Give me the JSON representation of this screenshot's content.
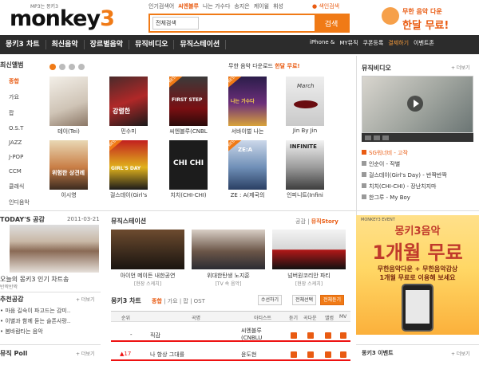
{
  "header": {
    "logo_tagline": "MP3는 몽키3",
    "logo_text": "monkey",
    "logo_num": "3",
    "popular_tags": [
      "인기검색어",
      "씨엔블루",
      "나는 가수다",
      "송지은",
      "케이윌",
      "휘성"
    ],
    "search_helper": "● 색인검색",
    "search_scope": "전체검색",
    "search_placeholder": "",
    "search_button": "검색",
    "promo_line1": "무한 음악 다운",
    "promo_line2": "한달 무료!"
  },
  "nav": {
    "items": [
      "몽키3 차트",
      "최신음악",
      "장르별음악",
      "뮤직비디오",
      "뮤직스테이션"
    ],
    "right": [
      "iPhone & ",
      "MY뮤직",
      "쿠폰등록",
      "결제하기",
      "이벤트존"
    ]
  },
  "album_section": {
    "title": "최신앨범",
    "categories": [
      "종합",
      "가요",
      "팝",
      "O.S.T",
      "JAZZ",
      "J-POP",
      "CCM",
      "클래식",
      "인디음악"
    ],
    "active_category": "종합",
    "promo_prefix": "무한 음악 다운로드",
    "promo_hi": "한달 무료!",
    "albums": [
      {
        "title": "테이(Tei)",
        "cover": "테이"
      },
      {
        "title": "민수미",
        "cover": "강렬한"
      },
      {
        "title": "씨엔블루(CNBL",
        "cover": "FIRST STEP"
      },
      {
        "title": "서바이벌 나는 ",
        "cover": "나는 가수다"
      },
      {
        "title": "Jin By Jin",
        "cover": "March"
      },
      {
        "title": "이시영",
        "cover": "위험한 상견례"
      },
      {
        "title": "걸스데이(Girl's",
        "cover": "GIRL'S DAY"
      },
      {
        "title": "치치(CHI-CHI)",
        "cover": "CHI CHI"
      },
      {
        "title": "ZE : A(제국의",
        "cover": "ZE:A"
      },
      {
        "title": "인피니트(Infini",
        "cover": "INFINITE"
      }
    ]
  },
  "video": {
    "title": "뮤직비디오",
    "more": "+ 더보기",
    "links": [
      "SG워너비 - 고작",
      "인순이 - 작별",
      "걸스데이(Girl's Day) - 반짝반짝",
      "치치(CHI-CHI) - 장난치지마",
      "한그루 - My Boy"
    ]
  },
  "today": {
    "title": "TODAY'S 공감",
    "date": "2011-03-21",
    "caption": "오늘의 몽키3 인기 차트송",
    "source": "반짝반짝"
  },
  "recommend": {
    "title": "추천공감",
    "more": "+ 더보기",
    "items": [
      "• 마음 길숙이 파고드는 감미..",
      "• 이별과 함께 듣는 슬픈사랑..",
      "• 봄바람타는 음악"
    ]
  },
  "poll": {
    "title": "뮤직 Poll",
    "more": "+ 더보기"
  },
  "station": {
    "title": "뮤직스테이션",
    "tab1": "공감",
    "tab2": "뮤직Story",
    "items": [
      {
        "title": "아이언 메이든 내한공연",
        "sub": "[현장 스케치]"
      },
      {
        "title": "위대한탄생 노지훈",
        "sub": "[TV 속 음악]"
      },
      {
        "title": "넘버원코리안 파티",
        "sub": "[현장 스케치]"
      }
    ]
  },
  "chart": {
    "title": "몽키3 차트",
    "tabs": [
      "종합",
      "가요",
      "팝",
      "OST"
    ],
    "buttons": [
      "수선하기",
      "전체선택",
      "전체듣기"
    ],
    "columns": [
      "순위",
      "곡명",
      "아티스트",
      "듣기",
      "곡다운",
      "앨범",
      "MV"
    ],
    "rows": [
      {
        "rank": "-",
        "title": "직감",
        "artist": "씨엔블루 (CNBLU"
      },
      {
        "rank": "▲17",
        "title": "나 항상 그대를",
        "artist": "윤도현"
      }
    ]
  },
  "ad": {
    "tag": "MONKEY3 EVENT",
    "line1": "몽키3음악",
    "line2": "1개월 무료",
    "line3": "무한음악다운 + 무한음악감상",
    "line4": "1개월 무료로 이용해 보세요"
  },
  "event": {
    "title": "몽키3 이벤트",
    "more": "+ 더보기"
  }
}
